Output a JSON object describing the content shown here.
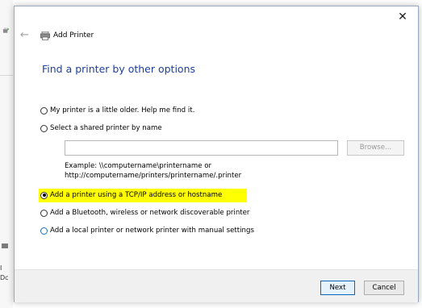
{
  "background": {
    "text1": "I",
    "text2": "Dc"
  },
  "dialog": {
    "title": "Add Printer",
    "heading": "Find a printer by other options",
    "options": [
      {
        "label": "My printer is a little older. Help me find it.",
        "checked": false
      },
      {
        "label": "Select a shared printer by name",
        "checked": false
      },
      {
        "label": "Add a printer using a TCP/IP address or hostname",
        "checked": true
      },
      {
        "label": "Add a Bluetooth, wireless or network discoverable printer",
        "checked": false
      },
      {
        "label": "Add a local printer or network printer with manual settings",
        "checked": false
      }
    ],
    "shared_printer": {
      "value": "",
      "browse_label": "Browse...",
      "example_line1": "Example: \\\\computername\\printername or",
      "example_line2": "http://computername/printers/printername/.printer"
    },
    "buttons": {
      "next": "Next",
      "cancel": "Cancel"
    }
  },
  "colors": {
    "heading": "#1c3f9e",
    "highlight": "#ffff00",
    "primary_button_border": "#0a66c2"
  }
}
